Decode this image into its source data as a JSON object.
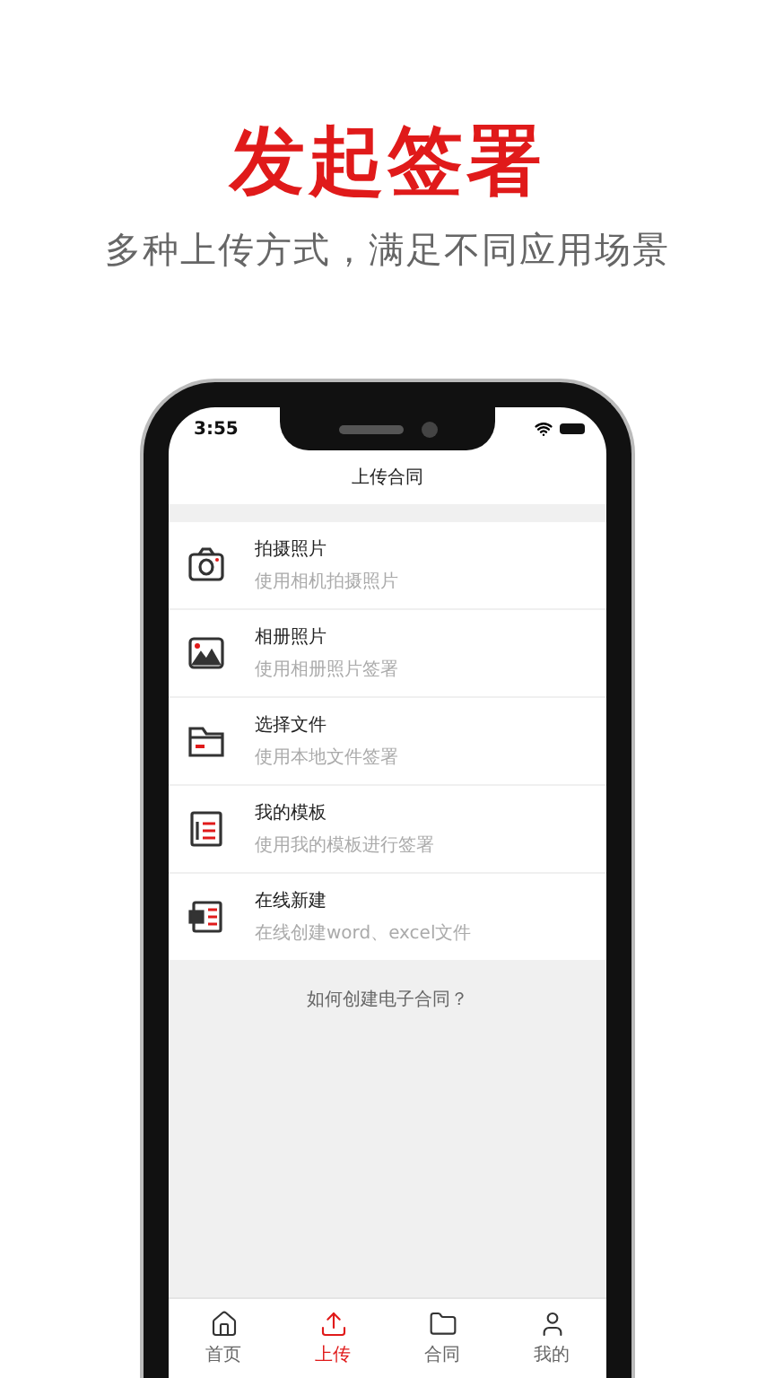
{
  "promo": {
    "headline": "发起签署",
    "subtitle": "多种上传方式，满足不同应用场景"
  },
  "status_bar": {
    "time": "3:55"
  },
  "nav": {
    "title": "上传合同"
  },
  "options": [
    {
      "kind": "camera",
      "title": "拍摄照片",
      "description": "使用相机拍摄照片"
    },
    {
      "kind": "album",
      "title": "相册照片",
      "description": "使用相册照片签署"
    },
    {
      "kind": "file",
      "title": "选择文件",
      "description": "使用本地文件签署"
    },
    {
      "kind": "template",
      "title": "我的模板",
      "description": "使用我的模板进行签署"
    },
    {
      "kind": "online",
      "title": "在线新建",
      "description": "在线创建word、excel文件"
    }
  ],
  "help_link": "如何创建电子合同？",
  "tabs": [
    {
      "kind": "home",
      "label": "首页",
      "selected": false
    },
    {
      "kind": "upload",
      "label": "上传",
      "selected": true
    },
    {
      "kind": "contract",
      "label": "合同",
      "selected": false
    },
    {
      "kind": "profile",
      "label": "我的",
      "selected": false
    }
  ]
}
